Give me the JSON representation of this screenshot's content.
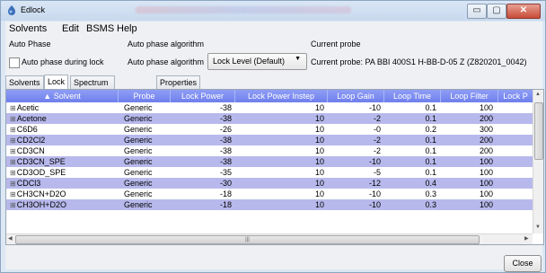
{
  "window": {
    "title": "Edlock"
  },
  "menu": [
    "Solvents",
    "Edit",
    "BSMS",
    "Help"
  ],
  "auto_phase": {
    "group_label": "Auto Phase",
    "checkbox_label": "Auto phase during lock",
    "checked": false
  },
  "algorithm": {
    "group_label": "Auto phase algorithm",
    "field_label": "Auto phase algorithm",
    "selected": "Lock Level (Default)"
  },
  "probe": {
    "group_label": "Current probe",
    "text": "Current probe: PA BBI 400S1 H-BB-D-05 Z (Z820201_0042)"
  },
  "tabs": [
    "Solvents",
    "Lock",
    "Spectrum Reference",
    "Properties"
  ],
  "active_tab": "Lock",
  "table": {
    "sort_indicator": "▲",
    "columns": [
      "Solvent",
      "Probe",
      "Lock Power",
      "Lock Power Instep",
      "Loop Gain",
      "Loop Time",
      "Loop Filter",
      "Lock P"
    ],
    "rows": [
      [
        "Acetic",
        "Generic",
        "-38",
        "10",
        "-10",
        "0.1",
        "100"
      ],
      [
        "Acetone",
        "Generic",
        "-38",
        "10",
        "-2",
        "0.1",
        "200"
      ],
      [
        "C6D6",
        "Generic",
        "-26",
        "10",
        "-0",
        "0.2",
        "300"
      ],
      [
        "CD2Cl2",
        "Generic",
        "-38",
        "10",
        "-2",
        "0.1",
        "200"
      ],
      [
        "CD3CN",
        "Generic",
        "-38",
        "10",
        "-2",
        "0.1",
        "200"
      ],
      [
        "CD3CN_SPE",
        "Generic",
        "-38",
        "10",
        "-10",
        "0.1",
        "100"
      ],
      [
        "CD3OD_SPE",
        "Generic",
        "-35",
        "10",
        "-5",
        "0.1",
        "100"
      ],
      [
        "CDCl3",
        "Generic",
        "-30",
        "10",
        "-12",
        "0.4",
        "100"
      ],
      [
        "CH3CN+D2O",
        "Generic",
        "-18",
        "10",
        "-10",
        "0.3",
        "100"
      ],
      [
        "CH3OH+D2O",
        "Generic",
        "-18",
        "10",
        "-10",
        "0.3",
        "100"
      ]
    ]
  },
  "close_label": "Close",
  "icons": {
    "app": "edlock-app-icon",
    "expander": "tree-expand-icon",
    "select_arrow": "dropdown-arrow-icon"
  }
}
